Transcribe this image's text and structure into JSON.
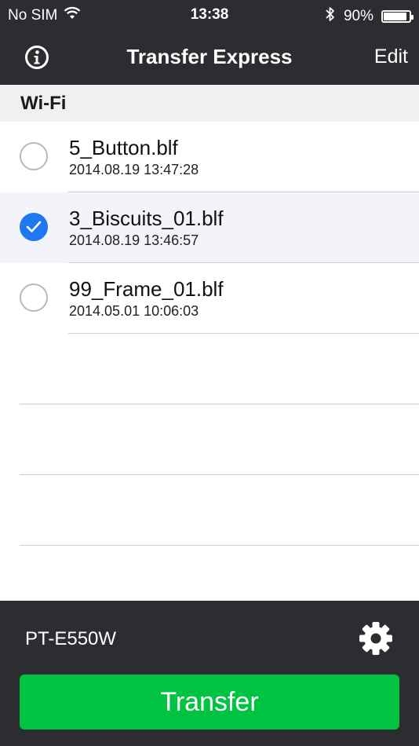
{
  "status_bar": {
    "carrier": "No SIM",
    "time": "13:38",
    "battery_text": "90%",
    "battery_level": 0.9
  },
  "nav": {
    "title": "Transfer Express",
    "edit_label": "Edit"
  },
  "section": {
    "title": "Wi-Fi"
  },
  "files": [
    {
      "name": "5_Button.blf",
      "date": "2014.08.19 13:47:28",
      "selected": false
    },
    {
      "name": "3_Biscuits_01.blf",
      "date": "2014.08.19 13:46:57",
      "selected": true
    },
    {
      "name": "99_Frame_01.blf",
      "date": "2014.05.01 10:06:03",
      "selected": false
    }
  ],
  "footer": {
    "printer_name": "PT-E550W",
    "transfer_label": "Transfer"
  },
  "colors": {
    "bar_background": "#2b2d31",
    "accent_blue": "#1e78f0",
    "transfer_green": "#00c341"
  }
}
